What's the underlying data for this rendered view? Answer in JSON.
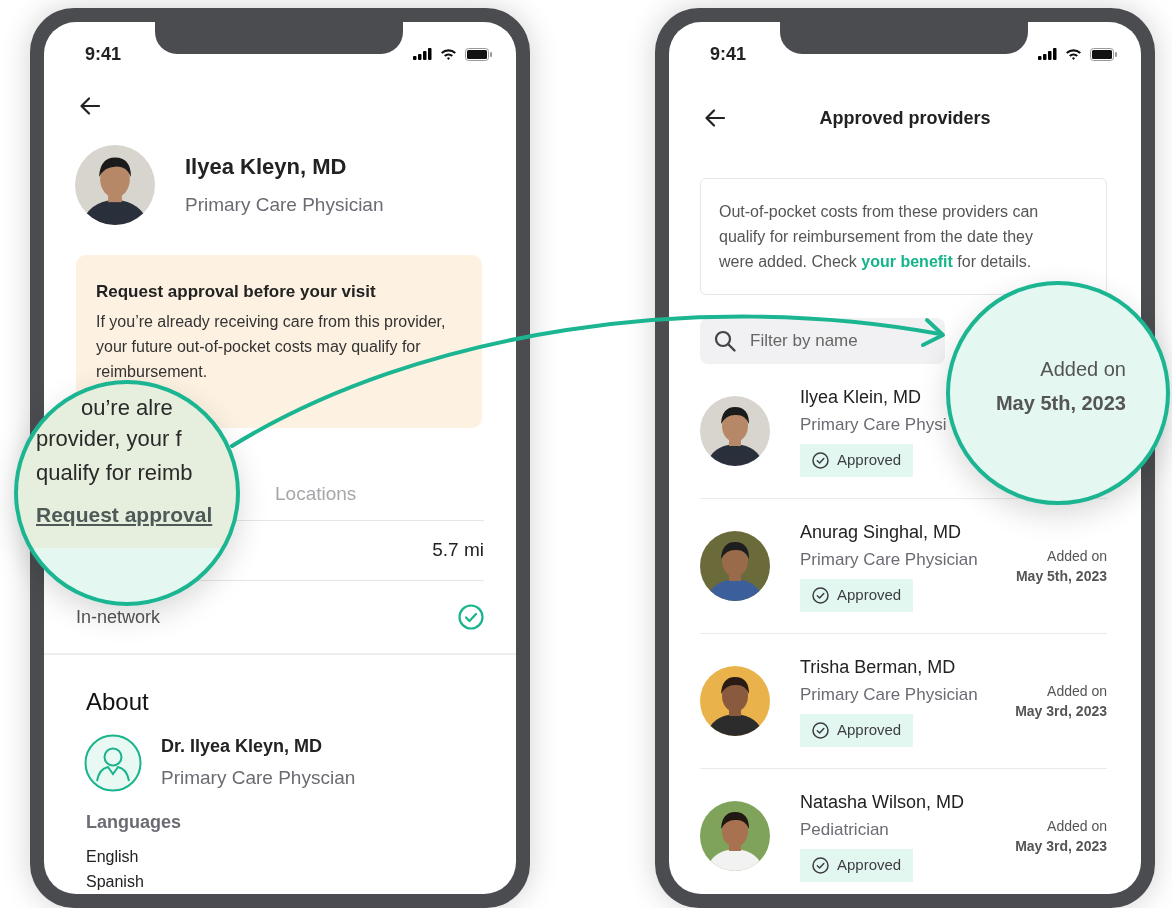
{
  "profile_screen": {
    "status_time": "9:41",
    "provider": {
      "name": "Ilyea Kleyn, MD",
      "specialty": "Primary Care Physician"
    },
    "notice": {
      "title": "Request approval before your visit",
      "body": "If you’re already receiving care from this provider, your future out-of-pocket costs may qualify for reimbursement."
    },
    "tabs": [
      {
        "label": "Locations",
        "selected": false
      }
    ],
    "distance": "5.7 mi",
    "in_network": {
      "label": "In-network",
      "checked": true
    },
    "about": {
      "heading": "About",
      "name": "Dr. Ilyea Kleyn, MD",
      "specialty": "Primary Care Physcian",
      "languages_label": "Languages",
      "languages": [
        "English",
        "Spanish"
      ]
    }
  },
  "providers_screen": {
    "status_time": "9:41",
    "title": "Approved providers",
    "info": {
      "text_before": "Out-of-pocket costs from these providers can qualify for reimbursement from the date they were added. Check ",
      "link": "your benefit",
      "text_after": " for details."
    },
    "search": {
      "placeholder": "Filter by name"
    },
    "providers": [
      {
        "name": "Ilyea Klein, MD",
        "specialty": "Primary Care Physi",
        "status": "Approved"
      },
      {
        "name": "Anurag Singhal, MD",
        "specialty": "Primary Care Physician",
        "status": "Approved",
        "added_label": "Added on",
        "added_date": "May 5th, 2023"
      },
      {
        "name": "Trisha Berman, MD",
        "specialty": "Primary Care Physician",
        "status": "Approved",
        "added_label": "Added on",
        "added_date": "May 3rd, 2023"
      },
      {
        "name": "Natasha Wilson, MD",
        "specialty": "Pediatrician",
        "status": "Approved",
        "added_label": "Added on",
        "added_date": "May 3rd, 2023"
      }
    ]
  },
  "callouts": {
    "notice_zoom": {
      "lines": [
        "ou’re alre",
        "provider, your f",
        "qualify for reimb"
      ],
      "link": "Request approval"
    },
    "date_zoom": {
      "added_label": "Added on",
      "added_date": "May 5th, 2023"
    }
  }
}
